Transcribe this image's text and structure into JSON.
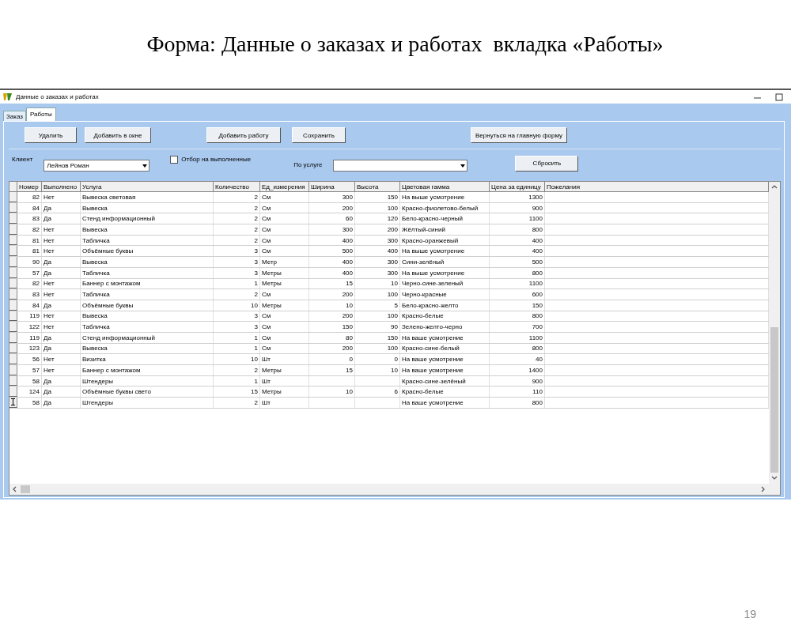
{
  "slide_title": "Форма: Данные о заказах и работах  вкладка «Работы»",
  "window": {
    "title": "Данные о заказах и работах"
  },
  "tabs": [
    {
      "label": "Заказ",
      "selected": false
    },
    {
      "label": "Работы",
      "selected": true
    }
  ],
  "buttons": [
    "Удалить",
    "Добавить в окне",
    "Добавить работу",
    "Сохранить",
    "Вернуться на главную форму"
  ],
  "filters": {
    "client_label": "Клиент",
    "client_value": "Лейнов Роман",
    "done_filter": {
      "label": "Отбор на выполненные",
      "checked": false
    },
    "service_label": "По услуге",
    "reset_button": "Сбросить"
  },
  "table": {
    "columns": [
      "Номер",
      "Выполнено",
      "Услуга",
      "Количество",
      "Ед_измерения",
      "Ширина",
      "Высота",
      "Цветовая гамма",
      "Цена за единицу",
      "Пожелания"
    ],
    "rows": [
      {
        "current": false,
        "cells": [
          "82",
          "Нет",
          "Вывеска световая",
          "2",
          "См",
          "300",
          "150",
          "На выше усмотрение",
          "1300"
        ]
      },
      {
        "current": false,
        "cells": [
          "84",
          "Да",
          "Вывеска",
          "2",
          "См",
          "200",
          "100",
          "Красно-фиолетово-белый",
          "900"
        ]
      },
      {
        "current": false,
        "cells": [
          "83",
          "Да",
          "Стенд информационный",
          "2",
          "См",
          "60",
          "120",
          "Бело-красно-черный",
          "1100"
        ]
      },
      {
        "current": false,
        "cells": [
          "82",
          "Нет",
          "Вывеска",
          "2",
          "См",
          "300",
          "200",
          "Жёлтый-синий",
          "800"
        ]
      },
      {
        "current": false,
        "cells": [
          "81",
          "Нет",
          "Табличка",
          "2",
          "См",
          "400",
          "300",
          "Красно-оранжевый",
          "400"
        ]
      },
      {
        "current": false,
        "cells": [
          "81",
          "Нет",
          "Объёмные буквы",
          "3",
          "См",
          "500",
          "400",
          "На выше усмотрение",
          "400"
        ]
      },
      {
        "current": false,
        "cells": [
          "90",
          "Да",
          "Вывеска",
          "3",
          "Метр",
          "400",
          "300",
          "Сини-зелёный",
          "500"
        ]
      },
      {
        "current": false,
        "cells": [
          "57",
          "Да",
          "Табличка",
          "3",
          "Метры",
          "400",
          "300",
          "На выше усмотрение",
          "800"
        ]
      },
      {
        "current": false,
        "cells": [
          "82",
          "Нет",
          "Баннер с монтажом",
          "1",
          "Метры",
          "15",
          "10",
          "Черно-сине-зеленый",
          "1100"
        ]
      },
      {
        "current": false,
        "cells": [
          "83",
          "Нет",
          "Табличка",
          "2",
          "См",
          "200",
          "100",
          "Черно-красные",
          "600"
        ]
      },
      {
        "current": false,
        "cells": [
          "84",
          "Да",
          "Объёмные буквы",
          "10",
          "Метры",
          "10",
          "5",
          "Бело-красно-желто",
          "150"
        ]
      },
      {
        "current": false,
        "cells": [
          "119",
          "Нет",
          "Вывеска",
          "3",
          "См",
          "200",
          "100",
          "Красно-белые",
          "800"
        ]
      },
      {
        "current": false,
        "cells": [
          "122",
          "Нет",
          "Табличка",
          "3",
          "См",
          "150",
          "90",
          "Зелено-желто-черно",
          "700"
        ]
      },
      {
        "current": false,
        "cells": [
          "119",
          "Да",
          "Стенд информационный",
          "1",
          "См",
          "80",
          "150",
          "На ваше усмотрение",
          "1100"
        ]
      },
      {
        "current": false,
        "cells": [
          "123",
          "Да",
          "Вывеска",
          "1",
          "См",
          "200",
          "100",
          "Красно-сине-белый",
          "800"
        ]
      },
      {
        "current": false,
        "cells": [
          "56",
          "Нет",
          "Визитка",
          "10",
          "Шт",
          "0",
          "0",
          "На ваше усмотрение",
          "40"
        ]
      },
      {
        "current": false,
        "cells": [
          "57",
          "Нет",
          "Баннер с монтажом",
          "2",
          "Метры",
          "15",
          "10",
          "На ваше усмотрение",
          "1400"
        ]
      },
      {
        "current": false,
        "cells": [
          "58",
          "Да",
          "Штендеры",
          "1",
          "Шт",
          "",
          "",
          "Красно-сине-зелёный",
          "900"
        ]
      },
      {
        "current": false,
        "cells": [
          "124",
          "Да",
          "Объёмные буквы свето",
          "15",
          "Метры",
          "10",
          "6",
          "Красно-белые",
          "110"
        ]
      },
      {
        "current": true,
        "cells": [
          "58",
          "Да",
          "Штендеры",
          "2",
          "Шт",
          "",
          "",
          "На ваше усмотрение",
          "800"
        ]
      }
    ]
  },
  "page_number": "19"
}
